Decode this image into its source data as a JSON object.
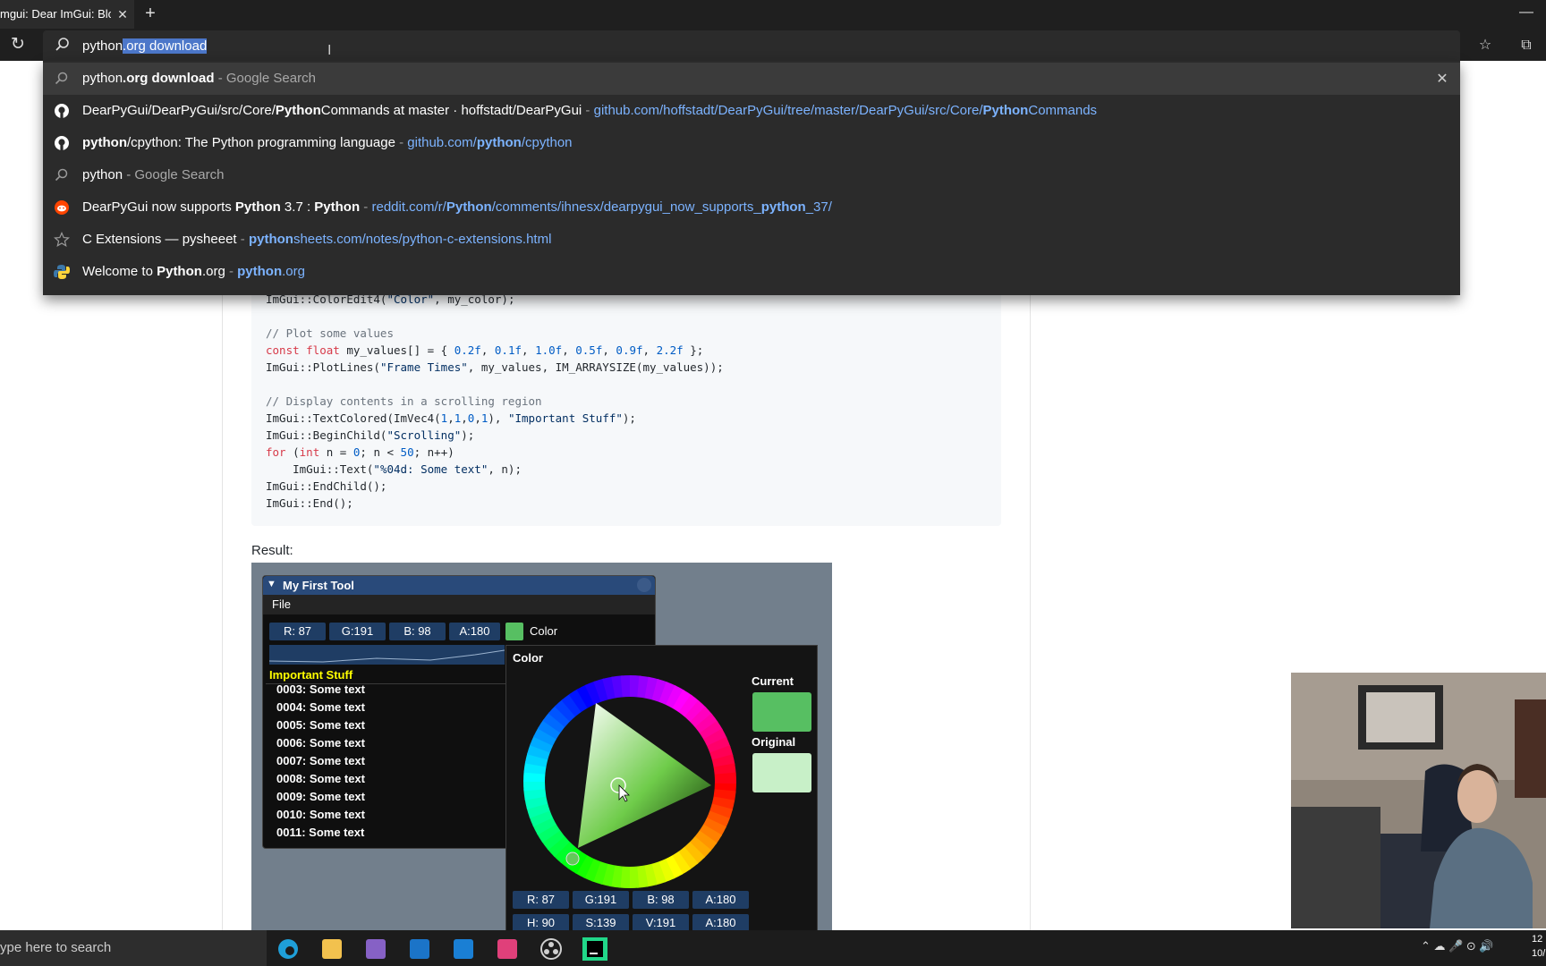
{
  "browser": {
    "tab_title": "mgui: Dear ImGui: Bloa",
    "omnibox": {
      "typed": "python",
      "autocompleted": ".org download"
    },
    "suggestions": [
      {
        "icon": "search-icon",
        "parts": [
          {
            "t": "python",
            "b": false
          },
          {
            "t": ".org download",
            "b": true
          }
        ],
        "tail": " - Google Search",
        "url": []
      },
      {
        "icon": "github-icon",
        "parts": [
          {
            "t": "DearPyGui/DearPyGui/src/Core/",
            "b": false
          },
          {
            "t": "Python",
            "b": true
          },
          {
            "t": "Commands at master · hoffstadt/DearPyGui",
            "b": false
          }
        ],
        "tail": " - ",
        "url": [
          {
            "t": "github.com/hoffstadt/DearPyGui/tree/master/DearPyGui/src/Core/",
            "b": false
          },
          {
            "t": "Python",
            "b": true
          },
          {
            "t": "Commands",
            "b": false
          }
        ]
      },
      {
        "icon": "github-icon",
        "parts": [
          {
            "t": "python",
            "b": true
          },
          {
            "t": "/cpython: The Python programming language",
            "b": false
          }
        ],
        "tail": " - ",
        "url": [
          {
            "t": "github.com/",
            "b": false
          },
          {
            "t": "python",
            "b": true
          },
          {
            "t": "/cpython",
            "b": false
          }
        ]
      },
      {
        "icon": "search-icon",
        "parts": [
          {
            "t": "python",
            "b": false
          }
        ],
        "tail": " - Google Search",
        "url": []
      },
      {
        "icon": "reddit-icon",
        "parts": [
          {
            "t": "DearPyGui now supports ",
            "b": false
          },
          {
            "t": "Python",
            "b": true
          },
          {
            "t": " 3.7 : ",
            "b": false
          },
          {
            "t": "Python",
            "b": true
          }
        ],
        "tail": " - ",
        "url": [
          {
            "t": "reddit.com/r/",
            "b": false
          },
          {
            "t": "Python",
            "b": true
          },
          {
            "t": "/comments/ihnesx/dearpygui_now_supports_",
            "b": false
          },
          {
            "t": "python",
            "b": true
          },
          {
            "t": "_37/",
            "b": false
          }
        ]
      },
      {
        "icon": "star-icon",
        "parts": [
          {
            "t": "C Extensions — pysheeet",
            "b": false
          }
        ],
        "tail": " - ",
        "url": [
          {
            "t": "python",
            "b": true
          },
          {
            "t": "sheets.com/notes/python-c-extensions.html",
            "b": false
          }
        ]
      },
      {
        "icon": "python-icon",
        "parts": [
          {
            "t": "Welcome to ",
            "b": false
          },
          {
            "t": "Python",
            "b": true
          },
          {
            "t": ".org",
            "b": false
          }
        ],
        "tail": " - ",
        "url": [
          {
            "t": "python",
            "b": true
          },
          {
            "t": ".org",
            "b": false
          }
        ]
      }
    ]
  },
  "page": {
    "code_lines": [
      [
        {
          "c": "",
          "t": "ImGui::ColorEdit4("
        },
        {
          "c": "str",
          "t": "\"Color\""
        },
        {
          "c": "",
          "t": ", my_color);"
        }
      ],
      [],
      [
        {
          "c": "comment",
          "t": "// Plot some values"
        }
      ],
      [
        {
          "c": "kw",
          "t": "const float"
        },
        {
          "c": "",
          "t": " my_values[] = { "
        },
        {
          "c": "num",
          "t": "0.2f"
        },
        {
          "c": "",
          "t": ", "
        },
        {
          "c": "num",
          "t": "0.1f"
        },
        {
          "c": "",
          "t": ", "
        },
        {
          "c": "num",
          "t": "1.0f"
        },
        {
          "c": "",
          "t": ", "
        },
        {
          "c": "num",
          "t": "0.5f"
        },
        {
          "c": "",
          "t": ", "
        },
        {
          "c": "num",
          "t": "0.9f"
        },
        {
          "c": "",
          "t": ", "
        },
        {
          "c": "num",
          "t": "2.2f"
        },
        {
          "c": "",
          "t": " };"
        }
      ],
      [
        {
          "c": "",
          "t": "ImGui::PlotLines("
        },
        {
          "c": "str",
          "t": "\"Frame Times\""
        },
        {
          "c": "",
          "t": ", my_values, IM_ARRAYSIZE(my_values));"
        }
      ],
      [],
      [
        {
          "c": "comment",
          "t": "// Display contents in a scrolling region"
        }
      ],
      [
        {
          "c": "",
          "t": "ImGui::TextColored(ImVec4("
        },
        {
          "c": "num",
          "t": "1"
        },
        {
          "c": "",
          "t": ","
        },
        {
          "c": "num",
          "t": "1"
        },
        {
          "c": "",
          "t": ","
        },
        {
          "c": "num",
          "t": "0"
        },
        {
          "c": "",
          "t": ","
        },
        {
          "c": "num",
          "t": "1"
        },
        {
          "c": "",
          "t": "), "
        },
        {
          "c": "str",
          "t": "\"Important Stuff\""
        },
        {
          "c": "",
          "t": ");"
        }
      ],
      [
        {
          "c": "",
          "t": "ImGui::BeginChild("
        },
        {
          "c": "str",
          "t": "\"Scrolling\""
        },
        {
          "c": "",
          "t": ");"
        }
      ],
      [
        {
          "c": "kw",
          "t": "for"
        },
        {
          "c": "",
          "t": " ("
        },
        {
          "c": "kw",
          "t": "int"
        },
        {
          "c": "",
          "t": " n = "
        },
        {
          "c": "num",
          "t": "0"
        },
        {
          "c": "",
          "t": "; n < "
        },
        {
          "c": "num",
          "t": "50"
        },
        {
          "c": "",
          "t": "; n++)"
        }
      ],
      [
        {
          "c": "",
          "t": "    ImGui::Text("
        },
        {
          "c": "str",
          "t": "\"%04d: Some text\""
        },
        {
          "c": "",
          "t": ", n);"
        }
      ],
      [
        {
          "c": "",
          "t": "ImGui::EndChild();"
        }
      ],
      [
        {
          "c": "",
          "t": "ImGui::End();"
        }
      ]
    ],
    "result_label": "Result:",
    "imgui": {
      "window_title": "My First Tool",
      "collapse_glyph": "▼",
      "menu_file": "File",
      "fields": [
        "R: 87",
        "G:191",
        "B: 98",
        "A:180"
      ],
      "color_label": "Color",
      "important": "Important Stuff",
      "scroll_items": [
        "0003: Some text",
        "0004: Some text",
        "0005: Some text",
        "0006: Some text",
        "0007: Some text",
        "0008: Some text",
        "0009: Some text",
        "0010: Some text",
        "0011: Some text"
      ],
      "picker_title": "Color",
      "picker_current": "Current",
      "picker_original": "Original",
      "picker_rgba": [
        "R: 87",
        "G:191",
        "B: 98",
        "A:180"
      ],
      "picker_hsva": [
        "H: 90",
        "S:139",
        "V:191",
        "A:180"
      ],
      "current_color": "#57bf62",
      "original_color": "#c8f0c8"
    }
  },
  "taskbar": {
    "search_placeholder": "ype here to search",
    "apps": [
      "edge-icon",
      "file-explorer-icon",
      "visual-studio-icon",
      "outlook-icon",
      "trello-icon",
      "figma-icon",
      "obs-icon",
      "pycharm-icon"
    ],
    "clock_time": "12",
    "clock_date": "10/"
  }
}
